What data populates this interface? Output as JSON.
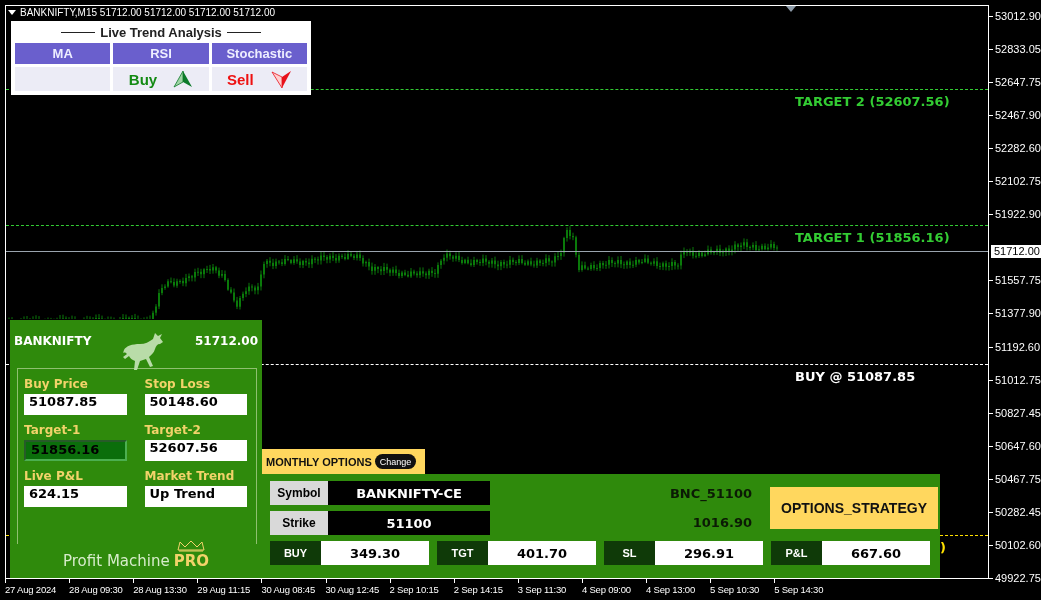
{
  "chart": {
    "caption": "BANKNIFTY,M15  51712.00 51712.00 51712.00 51712.00"
  },
  "trend_analysis": {
    "title": "Live Trend Analysis",
    "columns": [
      {
        "header": "MA"
      },
      {
        "header": "RSI",
        "signal": {
          "text": "Buy",
          "kind": "buy"
        }
      },
      {
        "header": "Stochastic",
        "signal": {
          "text": "Sell",
          "kind": "sell"
        }
      }
    ]
  },
  "levels": [
    {
      "kind": "target",
      "label": "TARGET 2 (52607.56)"
    },
    {
      "kind": "target",
      "label": "TARGET 1 (51856.16)"
    },
    {
      "kind": "current"
    },
    {
      "kind": "entry",
      "label": "BUY @ 51087.85"
    },
    {
      "kind": "stop",
      "label": ")"
    }
  ],
  "panel": {
    "symbol": "BANKNIFTY",
    "price": "51712.00",
    "fields": [
      {
        "label": "Buy Price",
        "value": "51087.85",
        "highlighted": false
      },
      {
        "label": "Stop Loss",
        "value": "50148.60",
        "highlighted": false
      },
      {
        "label": "Target-1",
        "value": "51856.16",
        "highlighted": true
      },
      {
        "label": "Target-2",
        "value": "52607.56",
        "highlighted": false
      },
      {
        "label": "Live P&L",
        "value": "624.15",
        "highlighted": false
      },
      {
        "label": "Market Trend",
        "value": "Up Trend",
        "highlighted": false
      }
    ],
    "brand": "Profit Machine",
    "brand_badge": "PRO"
  },
  "options": {
    "tab": "MONTHLY OPTIONS",
    "change_button": "Change",
    "rows": [
      {
        "label": "Symbol",
        "value": "BANKNIFTY-CE"
      },
      {
        "label": "Strike",
        "value": "51100"
      }
    ],
    "contract": "BNC_51100",
    "premium": "1016.90",
    "strategy_button": "OPTIONS_STRATEGY",
    "stats": [
      {
        "label": "BUY",
        "value": "349.30"
      },
      {
        "label": "TGT",
        "value": "401.70"
      },
      {
        "label": "SL",
        "value": "296.91"
      },
      {
        "label": "P&L",
        "value": "667.60"
      }
    ]
  },
  "price_axis": {
    "labels": [
      "53012.90",
      "52833.05",
      "52647.75",
      "52467.90",
      "52282.60",
      "52102.75",
      "51922.90",
      "51557.75",
      "51377.90",
      "51192.60",
      "51012.75",
      "50827.45",
      "50647.60",
      "50467.75",
      "50282.45",
      "50102.60",
      "49922.75"
    ],
    "current": "51712.00"
  },
  "time_axis": {
    "labels": [
      "27 Aug 2024",
      "28 Aug 09:30",
      "28 Aug 13:30",
      "29 Aug 11:15",
      "30 Aug 08:45",
      "30 Aug 12:45",
      "2 Sep 10:15",
      "2 Sep 14:15",
      "3 Sep 11:30",
      "4 Sep 09:00",
      "4 Sep 13:00",
      "5 Sep 10:30",
      "5 Sep 14:30"
    ]
  }
}
